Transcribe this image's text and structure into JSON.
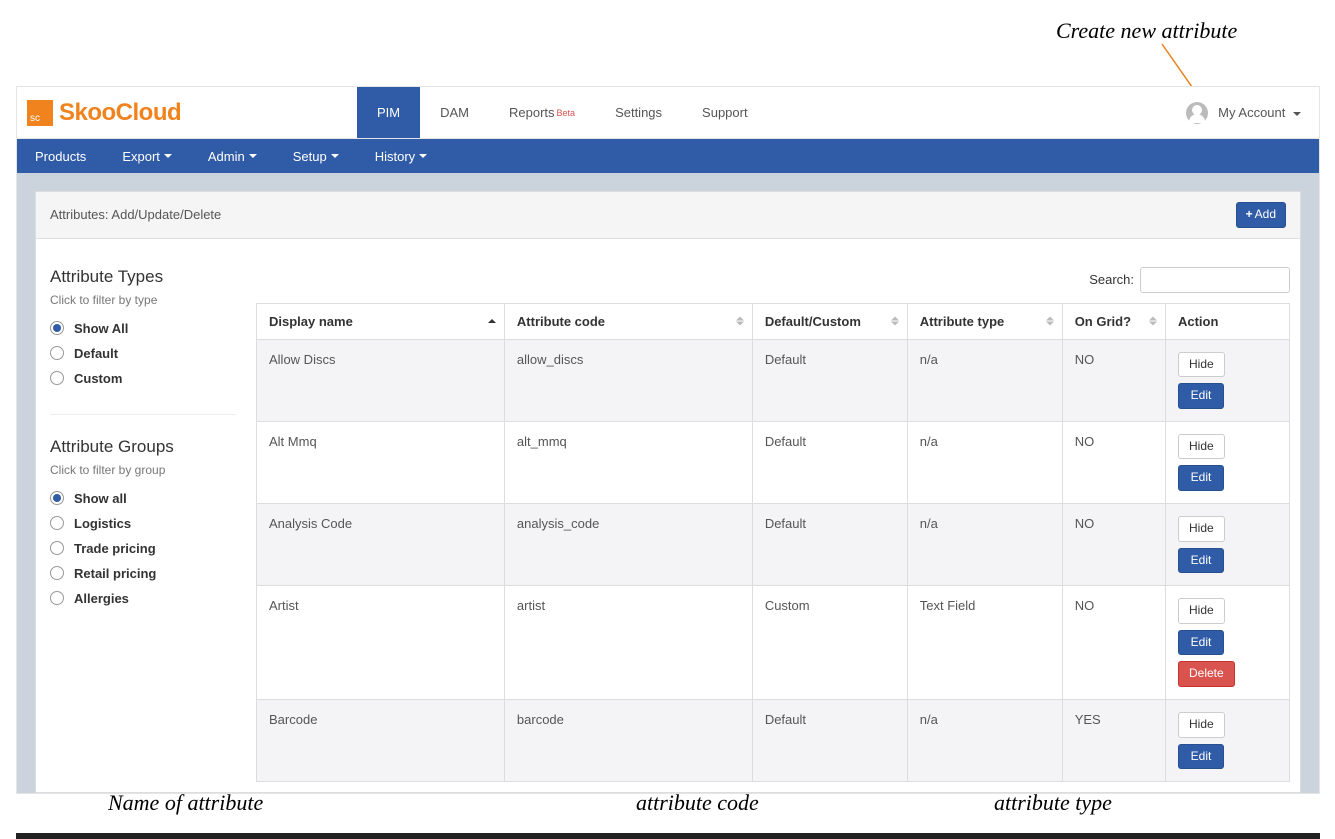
{
  "annotations": {
    "createNew": "Create new attribute",
    "name": "Name of attribute",
    "code": "attribute code",
    "type": "attribute type"
  },
  "logo": {
    "badge": "sc",
    "text": "SkooCloud"
  },
  "topnav": {
    "items": [
      {
        "label": "PIM",
        "active": true
      },
      {
        "label": "DAM",
        "active": false
      },
      {
        "label": "Reports",
        "badge": "Beta",
        "active": false
      },
      {
        "label": "Settings",
        "active": false
      },
      {
        "label": "Support",
        "active": false
      }
    ],
    "account": "My Account"
  },
  "secondbar": {
    "items": [
      {
        "label": "Products",
        "dropdown": false
      },
      {
        "label": "Export",
        "dropdown": true
      },
      {
        "label": "Admin",
        "dropdown": true
      },
      {
        "label": "Setup",
        "dropdown": true
      },
      {
        "label": "History",
        "dropdown": true
      }
    ]
  },
  "panel": {
    "title": "Attributes: Add/Update/Delete",
    "addLabel": "Add"
  },
  "sidebar": {
    "types": {
      "title": "Attribute Types",
      "sub": "Click to filter by type",
      "items": [
        {
          "label": "Show All",
          "checked": true
        },
        {
          "label": "Default",
          "checked": false
        },
        {
          "label": "Custom",
          "checked": false
        }
      ]
    },
    "groups": {
      "title": "Attribute Groups",
      "sub": "Click to filter by group",
      "items": [
        {
          "label": "Show all",
          "checked": true
        },
        {
          "label": "Logistics",
          "checked": false
        },
        {
          "label": "Trade pricing",
          "checked": false
        },
        {
          "label": "Retail pricing",
          "checked": false
        },
        {
          "label": "Allergies",
          "checked": false
        }
      ]
    }
  },
  "table": {
    "searchLabel": "Search:",
    "headers": [
      "Display name",
      "Attribute code",
      "Default/Custom",
      "Attribute type",
      "On Grid?",
      "Action"
    ],
    "actionLabels": {
      "hide": "Hide",
      "edit": "Edit",
      "delete": "Delete"
    },
    "rows": [
      {
        "displayName": "Allow Discs",
        "code": "allow_discs",
        "kind": "Default",
        "type": "n/a",
        "onGrid": "NO",
        "canDelete": false
      },
      {
        "displayName": "Alt Mmq",
        "code": "alt_mmq",
        "kind": "Default",
        "type": "n/a",
        "onGrid": "NO",
        "canDelete": false
      },
      {
        "displayName": "Analysis Code",
        "code": "analysis_code",
        "kind": "Default",
        "type": "n/a",
        "onGrid": "NO",
        "canDelete": false
      },
      {
        "displayName": "Artist",
        "code": "artist",
        "kind": "Custom",
        "type": "Text Field",
        "onGrid": "NO",
        "canDelete": true
      },
      {
        "displayName": "Barcode",
        "code": "barcode",
        "kind": "Default",
        "type": "n/a",
        "onGrid": "YES",
        "canDelete": false
      }
    ]
  }
}
